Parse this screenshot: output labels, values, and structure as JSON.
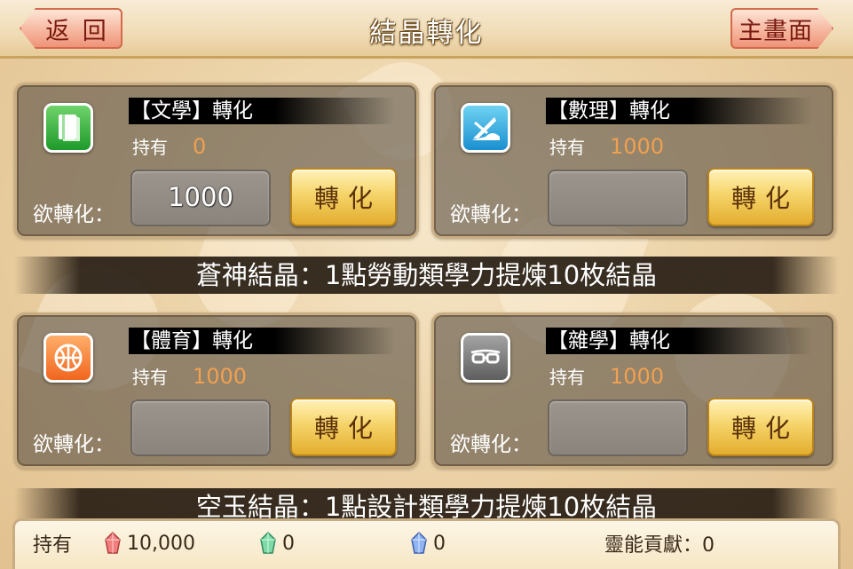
{
  "header": {
    "title": "結晶轉化",
    "back_label": "返 回",
    "home_label": "主畫面"
  },
  "panels": [
    {
      "icon": "book-icon",
      "title": "【文學】轉化",
      "held_label": "持有",
      "held_value": "0",
      "convert_label": "欲轉化：",
      "input_value": "1000",
      "button_label": "轉化"
    },
    {
      "icon": "geometry-icon",
      "title": "【數理】轉化",
      "held_label": "持有",
      "held_value": "1000",
      "convert_label": "欲轉化：",
      "input_value": "",
      "button_label": "轉化"
    },
    {
      "icon": "basketball-icon",
      "title": "【體育】轉化",
      "held_label": "持有",
      "held_value": "1000",
      "convert_label": "欲轉化：",
      "input_value": "",
      "button_label": "轉化"
    },
    {
      "icon": "glasses-icon",
      "title": "【雜學】轉化",
      "held_label": "持有",
      "held_value": "1000",
      "convert_label": "欲轉化：",
      "input_value": "",
      "button_label": "轉化"
    }
  ],
  "banners": {
    "first": "蒼神結晶：1點勞動類學力提煉10枚結晶",
    "second": "空玉結晶：1點設計類學力提煉10枚結晶"
  },
  "footer": {
    "held_label": "持有",
    "red_crystal": "10,000",
    "green_crystal": "0",
    "blue_crystal": "0",
    "contribution": "靈能貢獻：0"
  },
  "colors": {
    "held_value": "#f0a050",
    "button_gold": "#f6d46a",
    "nav_pink": "#f6b79f"
  }
}
